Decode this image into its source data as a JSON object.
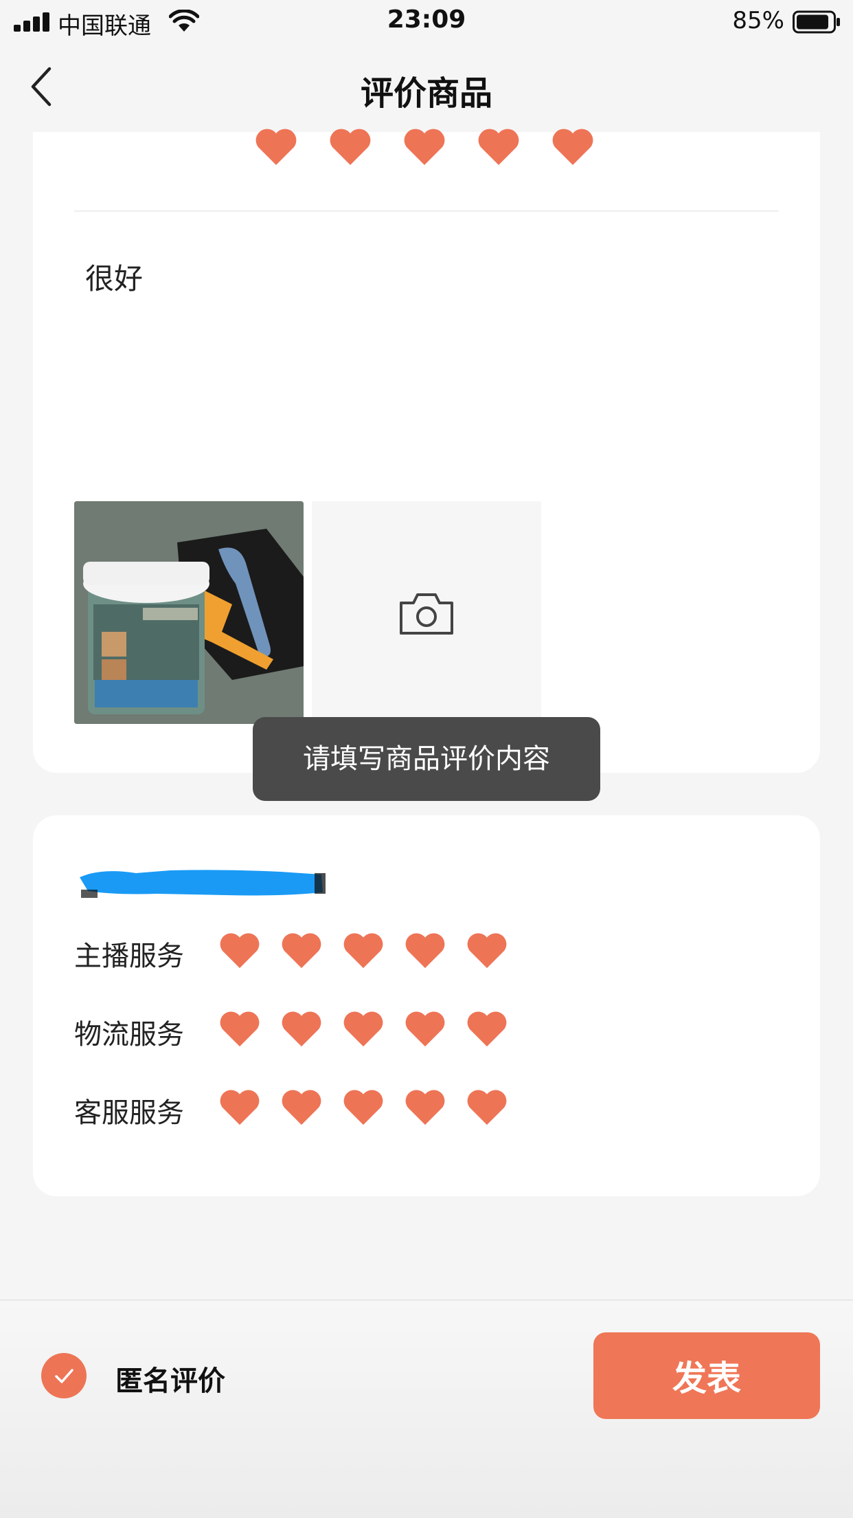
{
  "status_bar": {
    "carrier": "中国联通",
    "time": "23:09",
    "battery": "85%"
  },
  "nav": {
    "title": "评价商品"
  },
  "product_review": {
    "rating": 5,
    "max_rating": 5,
    "text": "很好",
    "photos": [
      {
        "alt": "木器修补膏"
      }
    ]
  },
  "toast": "请填写商品评价内容",
  "services": {
    "store_name": "",
    "items": [
      {
        "label": "主播服务",
        "rating": 5
      },
      {
        "label": "物流服务",
        "rating": 5
      },
      {
        "label": "客服服务",
        "rating": 5
      }
    ]
  },
  "bottom": {
    "anonymous_label": "匿名评价",
    "anonymous_checked": true,
    "publish_label": "发表"
  },
  "colors": {
    "accent": "#ef7656",
    "heart": "#ee7456",
    "toast_bg": "#4a4a4a",
    "redaction": "#1a9af5"
  }
}
